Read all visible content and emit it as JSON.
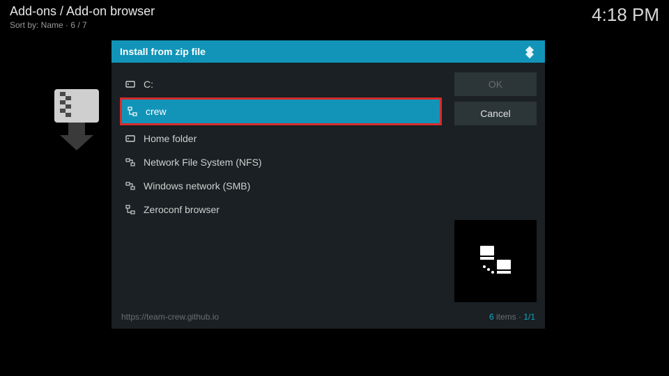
{
  "header": {
    "breadcrumb": "Add-ons / Add-on browser",
    "sort_label": "Sort by: Name",
    "sort_sep": " · ",
    "page_pos": "6 / 7",
    "clock": "4:18 PM"
  },
  "dialog": {
    "title": "Install from zip file",
    "sources": [
      {
        "label": "C:",
        "icon": "disk-icon",
        "selected": false
      },
      {
        "label": "crew",
        "icon": "netloc-icon",
        "selected": true
      },
      {
        "label": "Home folder",
        "icon": "disk-icon",
        "selected": false
      },
      {
        "label": "Network File System (NFS)",
        "icon": "network-icon",
        "selected": false
      },
      {
        "label": "Windows network (SMB)",
        "icon": "network-icon",
        "selected": false
      },
      {
        "label": "Zeroconf browser",
        "icon": "netloc-icon",
        "selected": false
      }
    ],
    "buttons": {
      "ok": "OK",
      "cancel": "Cancel"
    },
    "footer": {
      "url": "https://team-crew.github.io",
      "count_num": "6",
      "count_word": " items · ",
      "page": "1/1"
    }
  },
  "icons": {
    "disk-icon": "⛁",
    "netloc-icon": "⇅",
    "network-icon": "⇆"
  }
}
